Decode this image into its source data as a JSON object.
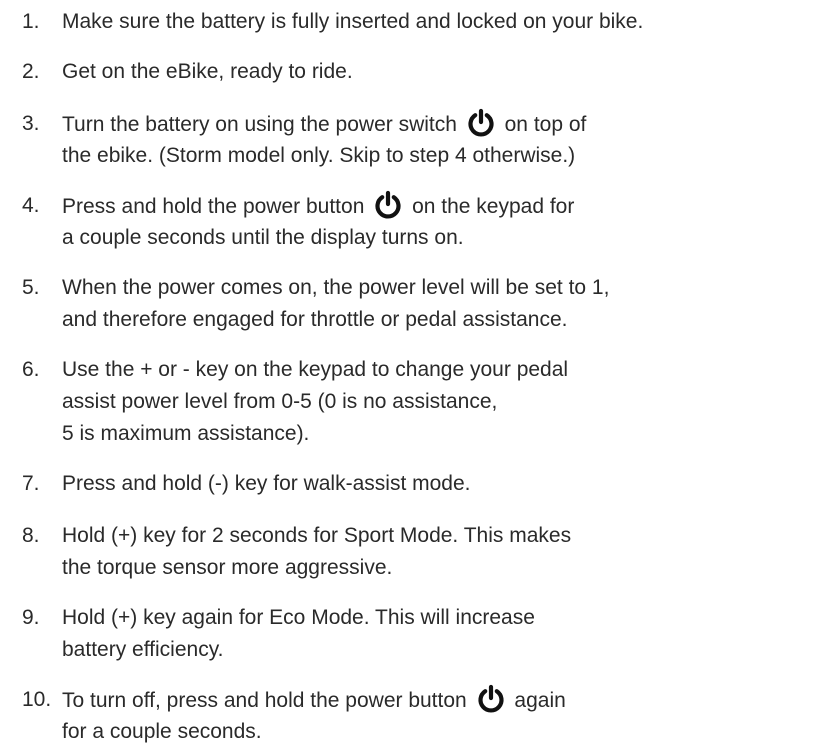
{
  "steps": [
    {
      "number": "1.",
      "lines": [
        "Make sure the battery is fully inserted and locked on your bike."
      ]
    },
    {
      "number": "2.",
      "lines": [
        "Get on the eBike, ready to ride."
      ]
    },
    {
      "number": "3.",
      "line1_before": "Turn the battery on using the power switch",
      "line1_after": "on top of",
      "lines_rest": [
        "the ebike. (Storm model only. Skip to step 4 otherwise.)"
      ]
    },
    {
      "number": "4.",
      "line1_before": "Press and hold the power button",
      "line1_after": "on the keypad for",
      "lines_rest": [
        "a couple seconds until the display turns on."
      ]
    },
    {
      "number": "5.",
      "lines": [
        "When the power comes on, the power level will be set to 1,",
        "and therefore engaged for throttle or pedal assistance."
      ]
    },
    {
      "number": "6.",
      "lines": [
        "Use the + or - key on the keypad to change your pedal",
        "assist power level from 0-5 (0 is no assistance,",
        "5 is maximum assistance)."
      ]
    },
    {
      "number": "7.",
      "lines": [
        "Press and hold (-) key for walk-assist mode."
      ]
    },
    {
      "number": "8.",
      "lines": [
        "Hold (+) key for 2 seconds for Sport Mode. This makes",
        "the torque sensor more aggressive."
      ]
    },
    {
      "number": "9.",
      "lines": [
        "Hold (+) key again for Eco Mode. This will increase",
        "battery efficiency."
      ]
    },
    {
      "number": "10.",
      "line1_before": "To turn off, press and hold the power button",
      "line1_after": "again",
      "lines_rest": [
        "for a couple seconds."
      ]
    }
  ],
  "icons": {
    "power": "power-icon"
  },
  "colors": {
    "text": "#2a2a2a",
    "icon": "#111111"
  }
}
